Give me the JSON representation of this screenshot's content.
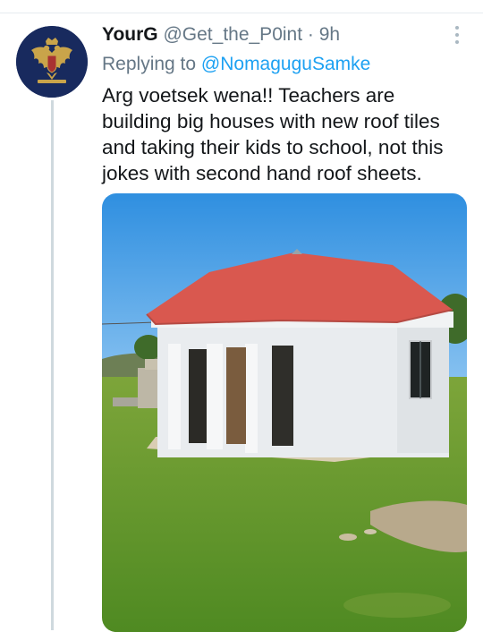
{
  "tweet": {
    "display_name": "YourG",
    "handle": "@Get_the_P0int",
    "separator": "·",
    "time": "9h",
    "replying_prefix": "Replying to",
    "replying_to": "@NomaguguSamke",
    "text": "Arg voetsek wena!! Teachers are building big houses with new roof tiles and taking their kids to school, not this jokes with second hand roof sheets."
  },
  "icons": {
    "more": "vertical-ellipsis-icon",
    "avatar": "double-headed-eagle-emblem"
  },
  "colors": {
    "link": "#1da1f2",
    "secondary_text": "#657786",
    "primary_text": "#14171a",
    "avatar_bg": "#182a5e"
  }
}
